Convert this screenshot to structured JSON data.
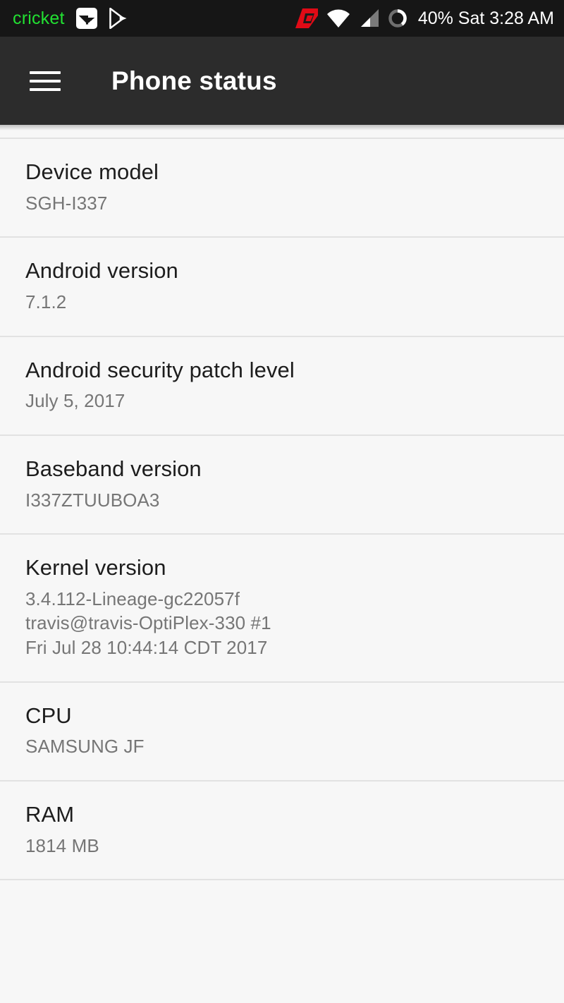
{
  "statusbar": {
    "carrier": "cricket",
    "icons": [
      "screenshot-icon",
      "play-store-icon",
      "app-logo-icon",
      "wifi-icon",
      "cellular-signal-icon",
      "battery-circle-icon"
    ],
    "battery_percent_label": "40%",
    "status_text": "40% Sat 3:28 AM",
    "day": "Sat",
    "time": "3:28 AM",
    "battery_level": 40,
    "carrier_color": "#22e032",
    "logo_color": "#e00a16",
    "background": "#161616"
  },
  "appbar": {
    "title": "Phone status",
    "menu_icon": "hamburger-menu-icon",
    "background": "#2c2c2c"
  },
  "list": {
    "items": [
      {
        "title": "Device model",
        "summary": "SGH-I337"
      },
      {
        "title": "Android version",
        "summary": "7.1.2"
      },
      {
        "title": "Android security patch level",
        "summary": "July 5, 2017"
      },
      {
        "title": "Baseband version",
        "summary": "I337ZTUUBOA3"
      },
      {
        "title": "Kernel version",
        "summary": "3.4.112-Lineage-gc22057f\ntravis@travis-OptiPlex-330 #1\nFri Jul 28 10:44:14 CDT 2017"
      },
      {
        "title": "CPU",
        "summary": "SAMSUNG JF"
      },
      {
        "title": "RAM",
        "summary": "1814 MB"
      }
    ]
  }
}
